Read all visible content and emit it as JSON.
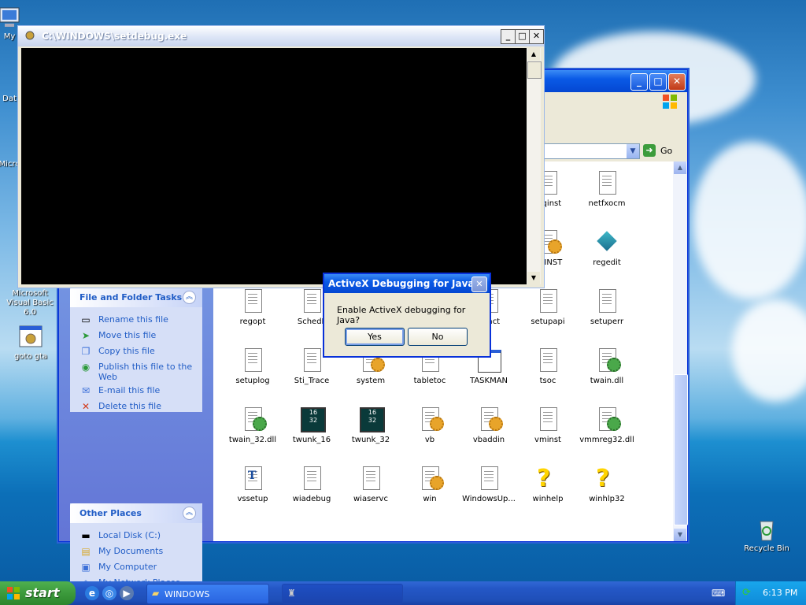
{
  "colors": {
    "xp_blue": "#0a5ae6",
    "sidebar_link": "#215dc6",
    "start_green": "#3c9a3c",
    "console_black": "#000000"
  },
  "desktop": {
    "icons": [
      {
        "label": "My",
        "icon": "my-computer-icon"
      },
      {
        "label": "Dat",
        "icon": "database-icon"
      },
      {
        "label": "Micro",
        "icon": "microsoft-app-icon"
      },
      {
        "label": "Microsoft Visual Basic 6.0",
        "icon": "visual-basic-icon"
      },
      {
        "label": "goto gta",
        "icon": "gear-shortcut-icon"
      },
      {
        "label": "Recycle Bin",
        "icon": "recycle-bin-icon"
      }
    ]
  },
  "explorer": {
    "address_go": "Go",
    "file_tasks": {
      "title": "File and Folder Tasks",
      "items": [
        {
          "label": "Rename this file",
          "icon": "rename-icon"
        },
        {
          "label": "Move this file",
          "icon": "move-icon"
        },
        {
          "label": "Copy this file",
          "icon": "copy-icon"
        },
        {
          "label": "Publish this file to the Web",
          "icon": "publish-icon"
        },
        {
          "label": "E-mail this file",
          "icon": "email-icon"
        },
        {
          "label": "Delete this file",
          "icon": "delete-icon"
        }
      ]
    },
    "other_places": {
      "title": "Other Places",
      "items": [
        {
          "label": "Local Disk (C:)",
          "icon": "disk-icon"
        },
        {
          "label": "My Documents",
          "icon": "documents-icon"
        },
        {
          "label": "My Computer",
          "icon": "computer-icon"
        },
        {
          "label": "My Network Places",
          "icon": "network-icon"
        }
      ]
    },
    "files": [
      {
        "name": "mqinst",
        "type": "doc"
      },
      {
        "name": "netfxocm",
        "type": "doc"
      },
      {
        "name": "BCINST",
        "type": "setup"
      },
      {
        "name": "regedit",
        "type": "regedit"
      },
      {
        "name": "regopt",
        "type": "doc"
      },
      {
        "name": "SchedL",
        "type": "doc"
      },
      {
        "name": "upact",
        "type": "doc"
      },
      {
        "name": "setupapi",
        "type": "doc"
      },
      {
        "name": "setuperr",
        "type": "doc"
      },
      {
        "name": "setuplog",
        "type": "doc"
      },
      {
        "name": "Sti_Trace",
        "type": "doc"
      },
      {
        "name": "system",
        "type": "setup"
      },
      {
        "name": "tabletoc",
        "type": "doc"
      },
      {
        "name": "TASKMAN",
        "type": "window"
      },
      {
        "name": "tsoc",
        "type": "doc"
      },
      {
        "name": "twain.dll",
        "type": "dll"
      },
      {
        "name": "twain_32.dll",
        "type": "dll"
      },
      {
        "name": "twunk_16",
        "type": "w16"
      },
      {
        "name": "twunk_32",
        "type": "w16"
      },
      {
        "name": "vb",
        "type": "setup"
      },
      {
        "name": "vbaddin",
        "type": "setup"
      },
      {
        "name": "vminst",
        "type": "doc"
      },
      {
        "name": "vmmreg32.dll",
        "type": "dll"
      },
      {
        "name": "vssetup",
        "type": "font"
      },
      {
        "name": "wiadebug",
        "type": "doc"
      },
      {
        "name": "wiaservc",
        "type": "doc"
      },
      {
        "name": "win",
        "type": "setup"
      },
      {
        "name": "WindowsUp...",
        "type": "doc"
      },
      {
        "name": "winhelp",
        "type": "help"
      },
      {
        "name": "winhlp32",
        "type": "help"
      }
    ]
  },
  "console": {
    "title": "C:\\WINDOWS\\setdebug.exe",
    "minimize": "_",
    "maximize": "□",
    "close": "✕"
  },
  "dialog": {
    "title": "ActiveX Debugging for Java",
    "message": "Enable ActiveX debugging for Java?",
    "yes": "Yes",
    "no": "No",
    "close": "✕"
  },
  "taskbar": {
    "start": "start",
    "tasks": [
      {
        "label": "WINDOWS",
        "icon": "folder-icon"
      },
      {
        "label": "",
        "icon": "console-icon"
      }
    ],
    "clock": "6:13 PM"
  }
}
